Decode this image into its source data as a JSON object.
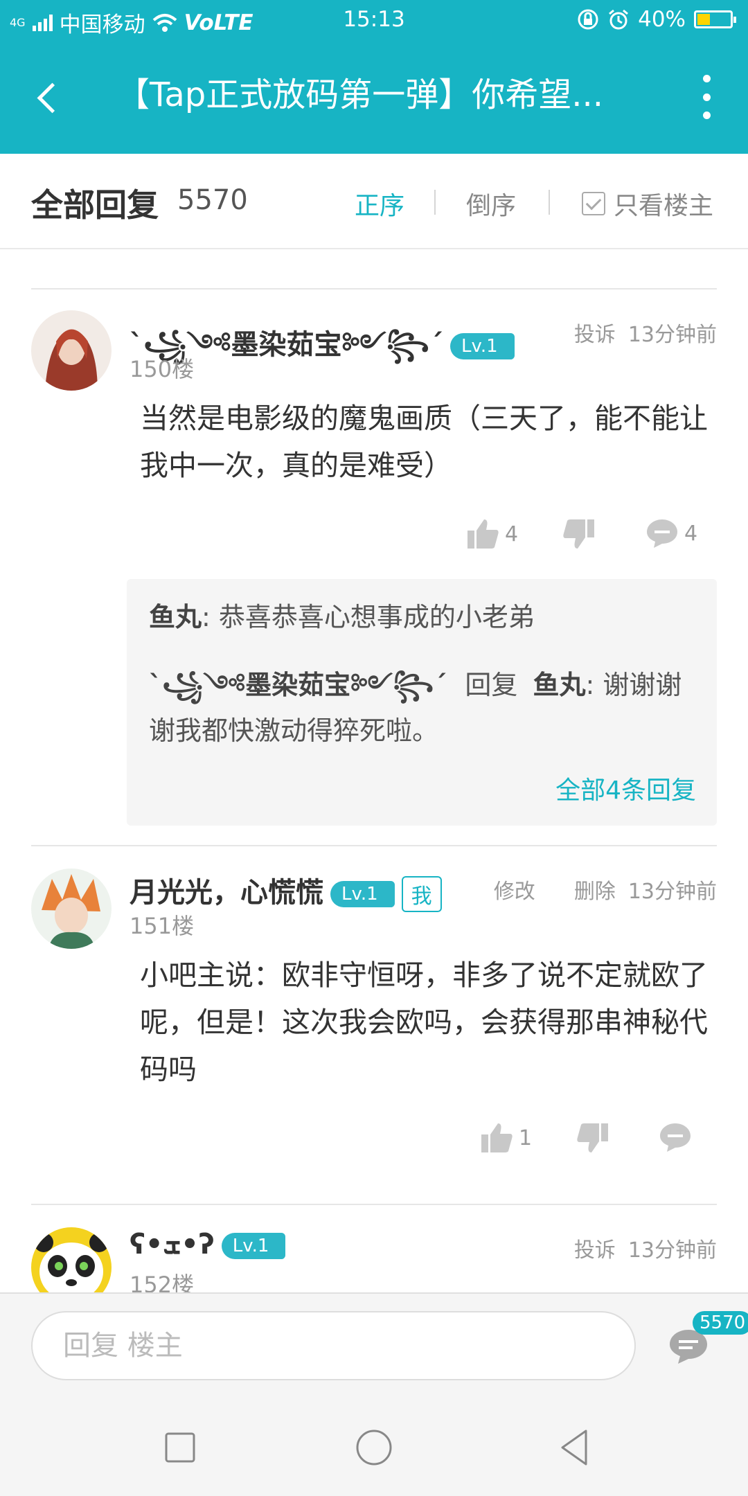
{
  "status_bar": {
    "network_tag": "4G",
    "carrier": "中国移动",
    "volte": "VoLTE",
    "time": "15:13",
    "battery": "40%",
    "battery_level": 0.4
  },
  "header": {
    "back_icon": "chevron-left-icon",
    "title": "【Tap正式放码第一弹】你希望...",
    "more_icon": "more-vertical-icon"
  },
  "sort_bar": {
    "title": "全部回复",
    "count": "5570",
    "asc_label": "正序",
    "desc_label": "倒序",
    "owner_only_label": "只看楼主"
  },
  "posts": [
    {
      "author": "ˋ꧁༺墨染茹宝༻꧂ˊ",
      "level": "Lv.1",
      "floor": "150楼",
      "report_label": "投诉",
      "time": "13分钟前",
      "content": "当然是电影级的魔鬼画质（三天了，能不能让我中一次，真的是难受）",
      "likes": "4",
      "comments": "4",
      "replies": [
        {
          "author": "鱼丸",
          "text": ": 恭喜恭喜心想事成的小老弟"
        },
        {
          "author": "ˋ꧁༺墨染茹宝༻꧂ˊ",
          "reply_word": "回复",
          "target": "鱼丸",
          "text": ": 谢谢谢谢我都快激动得猝死啦。"
        }
      ],
      "all_replies_label": "全部4条回复"
    },
    {
      "author": "月光光，心慌慌",
      "level": "Lv.1",
      "me_tag": "我",
      "floor": "151楼",
      "edit_label": "修改",
      "delete_label": "删除",
      "time": "13分钟前",
      "content": "小吧主说：欧非守恒呀，非多了说不定就欧了呢，但是！这次我会欧吗，会获得那串神秘代码吗",
      "likes": "1"
    },
    {
      "author": "ʕ•ܫ•ʔ",
      "level": "Lv.1",
      "floor": "152楼",
      "report_label": "投诉",
      "time": "13分钟前"
    }
  ],
  "bottom": {
    "reply_placeholder": "回复  楼主",
    "comment_count": "5570"
  },
  "colors": {
    "accent": "#17b4c4",
    "text": "#333333",
    "muted": "#999999"
  }
}
